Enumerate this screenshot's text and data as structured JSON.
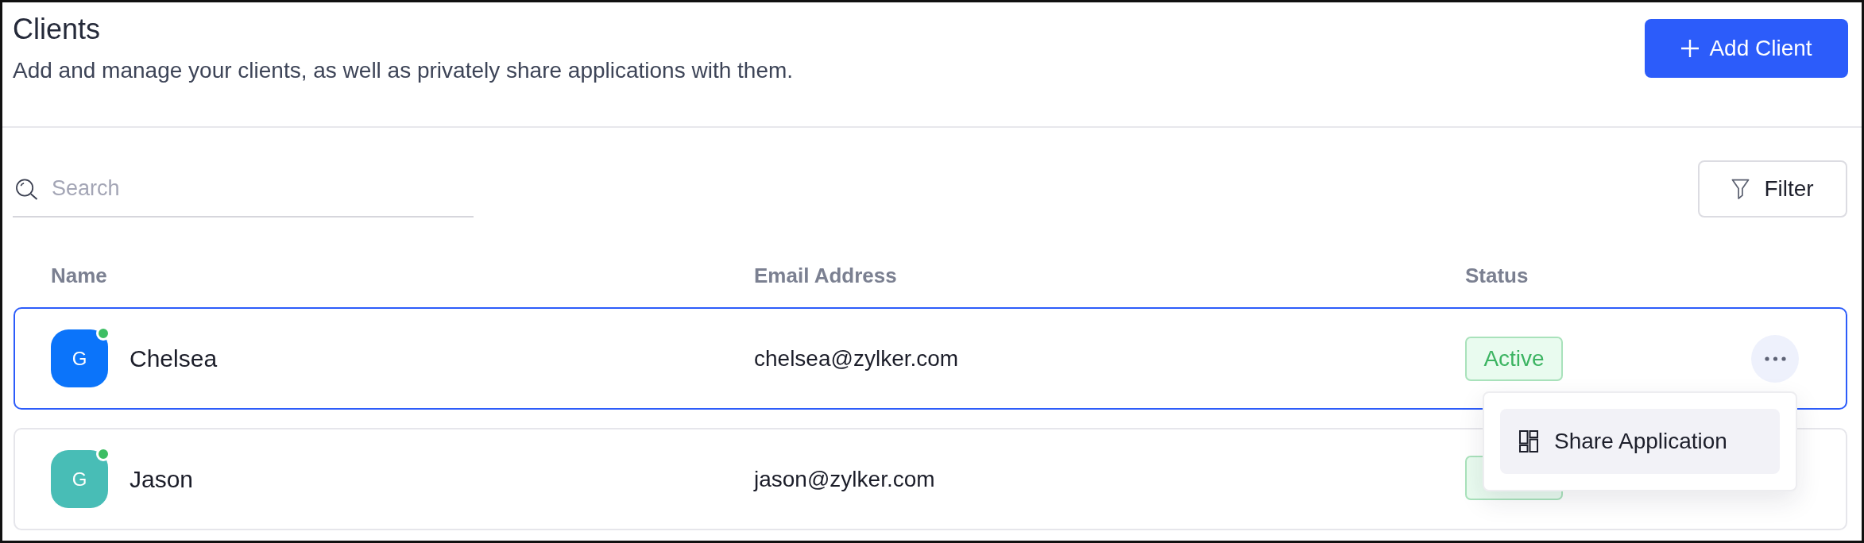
{
  "header": {
    "title": "Clients",
    "subtitle": "Add and manage your clients, as well as privately share applications with them.",
    "primary_button": {
      "label": "Add Client"
    }
  },
  "toolbar": {
    "search": {
      "placeholder": "Search"
    },
    "filter_button": {
      "label": "Filter"
    }
  },
  "table": {
    "columns": [
      "Name",
      "Email Address",
      "Status"
    ],
    "rows": [
      {
        "initial": "G",
        "color": "#0b74fa",
        "online": true,
        "name": "Chelsea",
        "email": "chelsea@zylker.com",
        "status": {
          "kind": "active",
          "label": "Active"
        },
        "selected": true,
        "actions_visible": true,
        "menu": {
          "items": [
            {
              "label": "Share Application",
              "selected": true
            }
          ]
        }
      },
      {
        "initial": "G",
        "color": "#48bdb6",
        "online": true,
        "name": "Jason",
        "email": "jason@zylker.com",
        "status": {
          "kind": "active"
        },
        "selected": false,
        "actions_visible": false
      }
    ]
  }
}
